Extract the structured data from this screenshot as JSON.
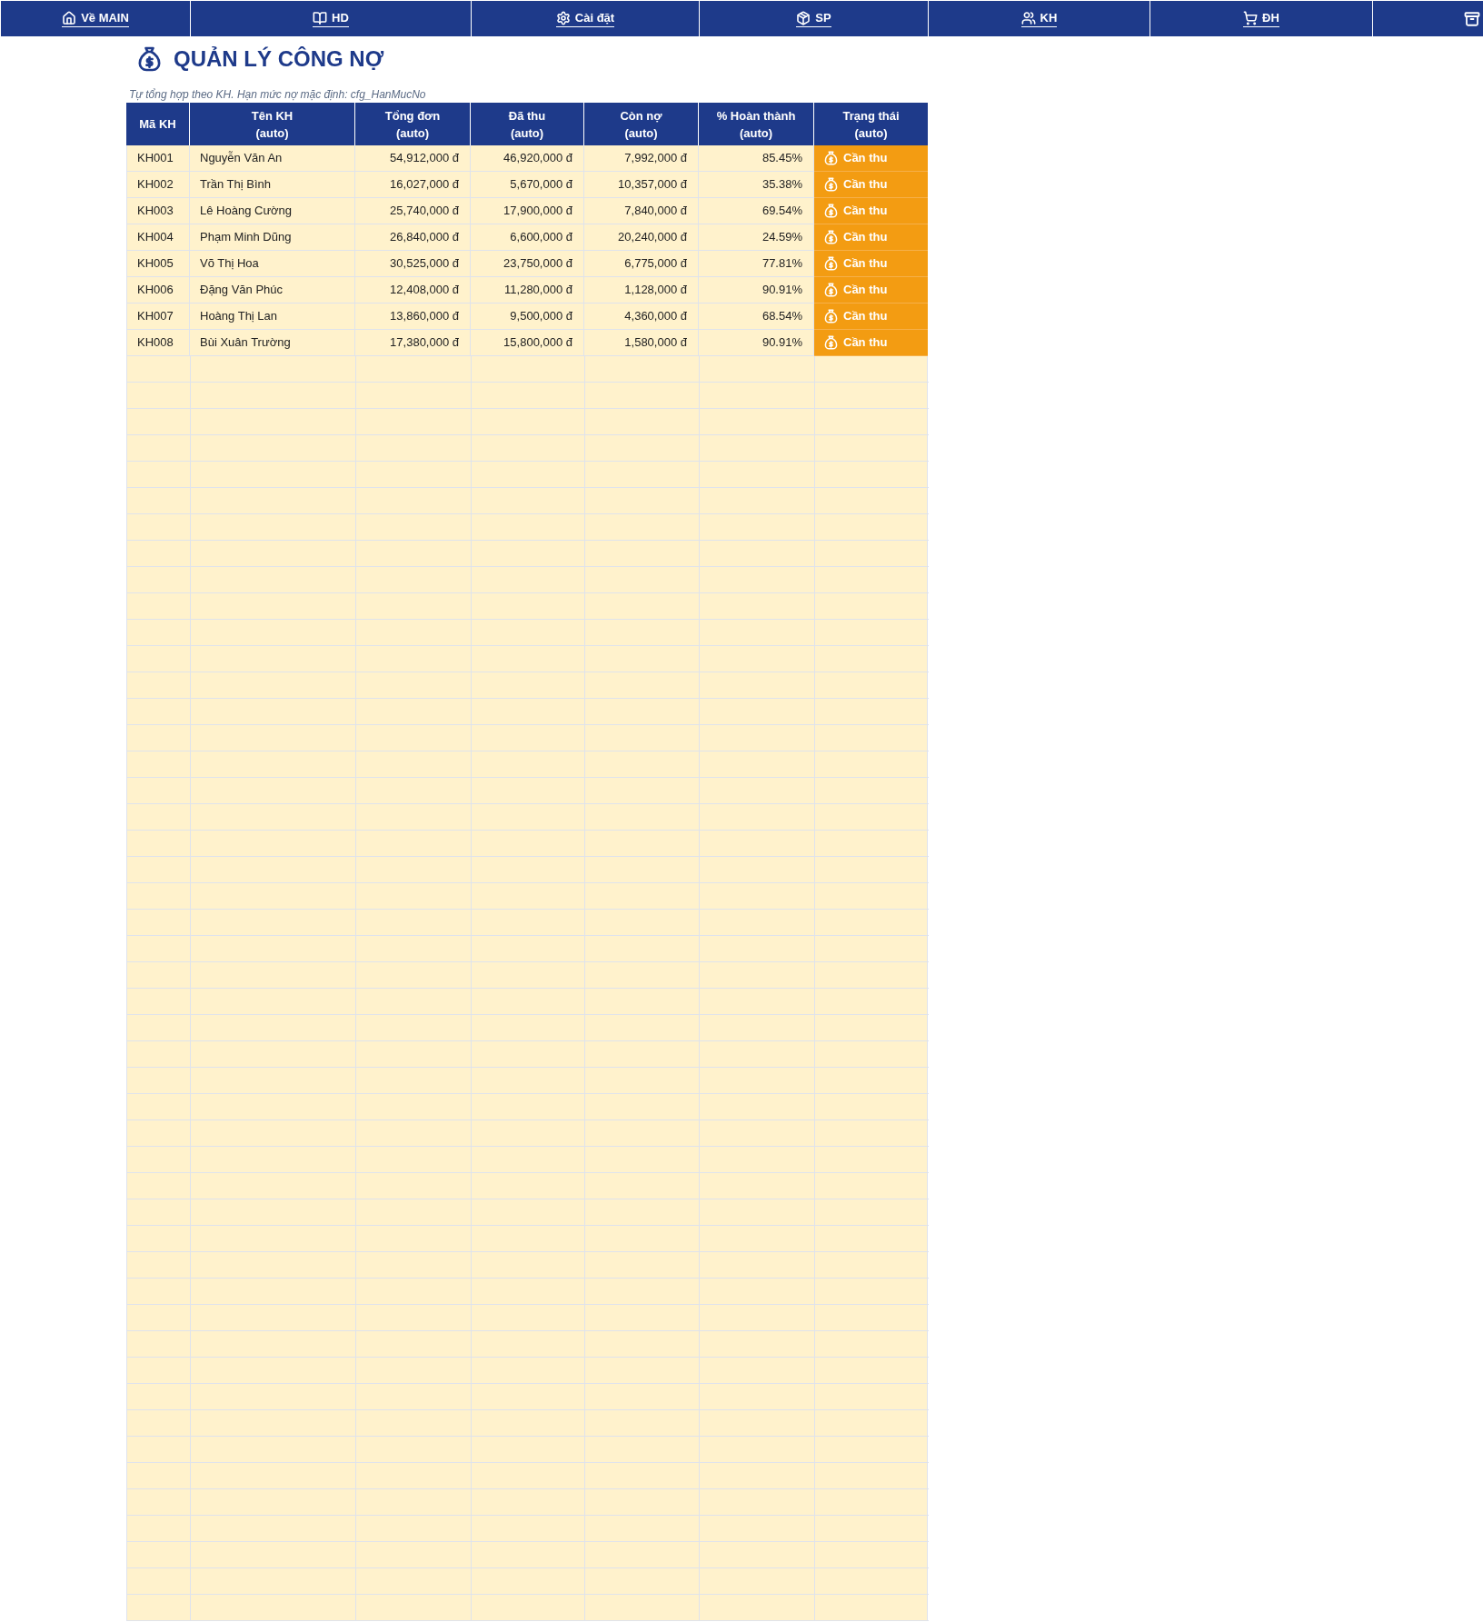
{
  "nav": {
    "items": [
      {
        "label": "Về MAIN"
      },
      {
        "label": "HD"
      },
      {
        "label": "Cài đặt"
      },
      {
        "label": "SP"
      },
      {
        "label": "KH"
      },
      {
        "label": "ĐH"
      }
    ]
  },
  "page": {
    "title": "QUẢN LÝ CÔNG NỢ",
    "subtitle": "Tự tổng hợp theo KH. Hạn mức nợ mặc định: cfg_HanMucNo"
  },
  "table": {
    "columns": [
      {
        "label": "Mã KH"
      },
      {
        "label": "Tên KH\n(auto)"
      },
      {
        "label": "Tổng đơn\n(auto)"
      },
      {
        "label": "Đã thu\n(auto)"
      },
      {
        "label": "Còn nợ\n(auto)"
      },
      {
        "label": "% Hoàn thành\n(auto)"
      },
      {
        "label": "Trạng thái\n(auto)"
      }
    ],
    "rows": [
      {
        "id": "KH001",
        "name": "Nguyễn Văn An",
        "total": "54,912,000 đ",
        "paid": "46,920,000 đ",
        "remaining": "7,992,000 đ",
        "completion": "85.45%",
        "status": {
          "label": "Cần thu",
          "kind": "due"
        }
      },
      {
        "id": "KH002",
        "name": "Trần Thị Bình",
        "total": "16,027,000 đ",
        "paid": "5,670,000 đ",
        "remaining": "10,357,000 đ",
        "completion": "35.38%",
        "status": {
          "label": "Cần thu",
          "kind": "due"
        }
      },
      {
        "id": "KH003",
        "name": "Lê Hoàng Cường",
        "total": "25,740,000 đ",
        "paid": "17,900,000 đ",
        "remaining": "7,840,000 đ",
        "completion": "69.54%",
        "status": {
          "label": "Cần thu",
          "kind": "due"
        }
      },
      {
        "id": "KH004",
        "name": "Phạm Minh Dũng",
        "total": "26,840,000 đ",
        "paid": "6,600,000 đ",
        "remaining": "20,240,000 đ",
        "completion": "24.59%",
        "status": {
          "label": "Cần thu",
          "kind": "due"
        }
      },
      {
        "id": "KH005",
        "name": "Võ Thị Hoa",
        "total": "30,525,000 đ",
        "paid": "23,750,000 đ",
        "remaining": "6,775,000 đ",
        "completion": "77.81%",
        "status": {
          "label": "Cần thu",
          "kind": "due"
        }
      },
      {
        "id": "KH006",
        "name": "Đặng Văn Phúc",
        "total": "12,408,000 đ",
        "paid": "11,280,000 đ",
        "remaining": "1,128,000 đ",
        "completion": "90.91%",
        "status": {
          "label": "Cần thu",
          "kind": "due"
        }
      },
      {
        "id": "KH007",
        "name": "Hoàng Thị Lan",
        "total": "13,860,000 đ",
        "paid": "9,500,000 đ",
        "remaining": "4,360,000 đ",
        "completion": "68.54%",
        "status": {
          "label": "Cần thu",
          "kind": "due"
        }
      },
      {
        "id": "KH008",
        "name": "Bùi Xuân Trường",
        "total": "17,380,000 đ",
        "paid": "15,800,000 đ",
        "remaining": "1,580,000 đ",
        "completion": "90.91%",
        "status": {
          "label": "Cần thu",
          "kind": "due"
        }
      }
    ]
  }
}
